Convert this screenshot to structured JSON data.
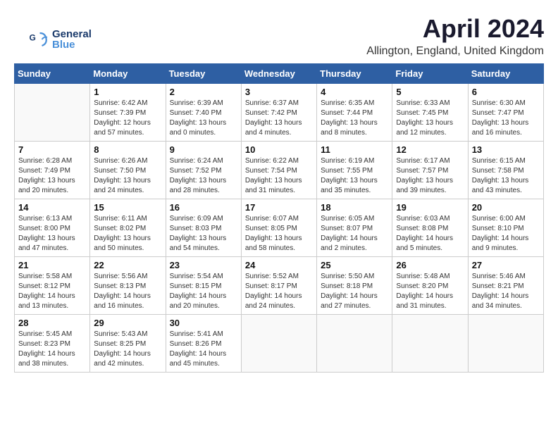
{
  "logo": {
    "line1": "General",
    "line2": "Blue"
  },
  "header": {
    "month_year": "April 2024",
    "location": "Allington, England, United Kingdom"
  },
  "weekdays": [
    "Sunday",
    "Monday",
    "Tuesday",
    "Wednesday",
    "Thursday",
    "Friday",
    "Saturday"
  ],
  "weeks": [
    [
      {
        "day": "",
        "sunrise": "",
        "sunset": "",
        "daylight": ""
      },
      {
        "day": "1",
        "sunrise": "Sunrise: 6:42 AM",
        "sunset": "Sunset: 7:39 PM",
        "daylight": "Daylight: 12 hours and 57 minutes."
      },
      {
        "day": "2",
        "sunrise": "Sunrise: 6:39 AM",
        "sunset": "Sunset: 7:40 PM",
        "daylight": "Daylight: 13 hours and 0 minutes."
      },
      {
        "day": "3",
        "sunrise": "Sunrise: 6:37 AM",
        "sunset": "Sunset: 7:42 PM",
        "daylight": "Daylight: 13 hours and 4 minutes."
      },
      {
        "day": "4",
        "sunrise": "Sunrise: 6:35 AM",
        "sunset": "Sunset: 7:44 PM",
        "daylight": "Daylight: 13 hours and 8 minutes."
      },
      {
        "day": "5",
        "sunrise": "Sunrise: 6:33 AM",
        "sunset": "Sunset: 7:45 PM",
        "daylight": "Daylight: 13 hours and 12 minutes."
      },
      {
        "day": "6",
        "sunrise": "Sunrise: 6:30 AM",
        "sunset": "Sunset: 7:47 PM",
        "daylight": "Daylight: 13 hours and 16 minutes."
      }
    ],
    [
      {
        "day": "7",
        "sunrise": "Sunrise: 6:28 AM",
        "sunset": "Sunset: 7:49 PM",
        "daylight": "Daylight: 13 hours and 20 minutes."
      },
      {
        "day": "8",
        "sunrise": "Sunrise: 6:26 AM",
        "sunset": "Sunset: 7:50 PM",
        "daylight": "Daylight: 13 hours and 24 minutes."
      },
      {
        "day": "9",
        "sunrise": "Sunrise: 6:24 AM",
        "sunset": "Sunset: 7:52 PM",
        "daylight": "Daylight: 13 hours and 28 minutes."
      },
      {
        "day": "10",
        "sunrise": "Sunrise: 6:22 AM",
        "sunset": "Sunset: 7:54 PM",
        "daylight": "Daylight: 13 hours and 31 minutes."
      },
      {
        "day": "11",
        "sunrise": "Sunrise: 6:19 AM",
        "sunset": "Sunset: 7:55 PM",
        "daylight": "Daylight: 13 hours and 35 minutes."
      },
      {
        "day": "12",
        "sunrise": "Sunrise: 6:17 AM",
        "sunset": "Sunset: 7:57 PM",
        "daylight": "Daylight: 13 hours and 39 minutes."
      },
      {
        "day": "13",
        "sunrise": "Sunrise: 6:15 AM",
        "sunset": "Sunset: 7:58 PM",
        "daylight": "Daylight: 13 hours and 43 minutes."
      }
    ],
    [
      {
        "day": "14",
        "sunrise": "Sunrise: 6:13 AM",
        "sunset": "Sunset: 8:00 PM",
        "daylight": "Daylight: 13 hours and 47 minutes."
      },
      {
        "day": "15",
        "sunrise": "Sunrise: 6:11 AM",
        "sunset": "Sunset: 8:02 PM",
        "daylight": "Daylight: 13 hours and 50 minutes."
      },
      {
        "day": "16",
        "sunrise": "Sunrise: 6:09 AM",
        "sunset": "Sunset: 8:03 PM",
        "daylight": "Daylight: 13 hours and 54 minutes."
      },
      {
        "day": "17",
        "sunrise": "Sunrise: 6:07 AM",
        "sunset": "Sunset: 8:05 PM",
        "daylight": "Daylight: 13 hours and 58 minutes."
      },
      {
        "day": "18",
        "sunrise": "Sunrise: 6:05 AM",
        "sunset": "Sunset: 8:07 PM",
        "daylight": "Daylight: 14 hours and 2 minutes."
      },
      {
        "day": "19",
        "sunrise": "Sunrise: 6:03 AM",
        "sunset": "Sunset: 8:08 PM",
        "daylight": "Daylight: 14 hours and 5 minutes."
      },
      {
        "day": "20",
        "sunrise": "Sunrise: 6:00 AM",
        "sunset": "Sunset: 8:10 PM",
        "daylight": "Daylight: 14 hours and 9 minutes."
      }
    ],
    [
      {
        "day": "21",
        "sunrise": "Sunrise: 5:58 AM",
        "sunset": "Sunset: 8:12 PM",
        "daylight": "Daylight: 14 hours and 13 minutes."
      },
      {
        "day": "22",
        "sunrise": "Sunrise: 5:56 AM",
        "sunset": "Sunset: 8:13 PM",
        "daylight": "Daylight: 14 hours and 16 minutes."
      },
      {
        "day": "23",
        "sunrise": "Sunrise: 5:54 AM",
        "sunset": "Sunset: 8:15 PM",
        "daylight": "Daylight: 14 hours and 20 minutes."
      },
      {
        "day": "24",
        "sunrise": "Sunrise: 5:52 AM",
        "sunset": "Sunset: 8:17 PM",
        "daylight": "Daylight: 14 hours and 24 minutes."
      },
      {
        "day": "25",
        "sunrise": "Sunrise: 5:50 AM",
        "sunset": "Sunset: 8:18 PM",
        "daylight": "Daylight: 14 hours and 27 minutes."
      },
      {
        "day": "26",
        "sunrise": "Sunrise: 5:48 AM",
        "sunset": "Sunset: 8:20 PM",
        "daylight": "Daylight: 14 hours and 31 minutes."
      },
      {
        "day": "27",
        "sunrise": "Sunrise: 5:46 AM",
        "sunset": "Sunset: 8:21 PM",
        "daylight": "Daylight: 14 hours and 34 minutes."
      }
    ],
    [
      {
        "day": "28",
        "sunrise": "Sunrise: 5:45 AM",
        "sunset": "Sunset: 8:23 PM",
        "daylight": "Daylight: 14 hours and 38 minutes."
      },
      {
        "day": "29",
        "sunrise": "Sunrise: 5:43 AM",
        "sunset": "Sunset: 8:25 PM",
        "daylight": "Daylight: 14 hours and 42 minutes."
      },
      {
        "day": "30",
        "sunrise": "Sunrise: 5:41 AM",
        "sunset": "Sunset: 8:26 PM",
        "daylight": "Daylight: 14 hours and 45 minutes."
      },
      {
        "day": "",
        "sunrise": "",
        "sunset": "",
        "daylight": ""
      },
      {
        "day": "",
        "sunrise": "",
        "sunset": "",
        "daylight": ""
      },
      {
        "day": "",
        "sunrise": "",
        "sunset": "",
        "daylight": ""
      },
      {
        "day": "",
        "sunrise": "",
        "sunset": "",
        "daylight": ""
      }
    ]
  ]
}
